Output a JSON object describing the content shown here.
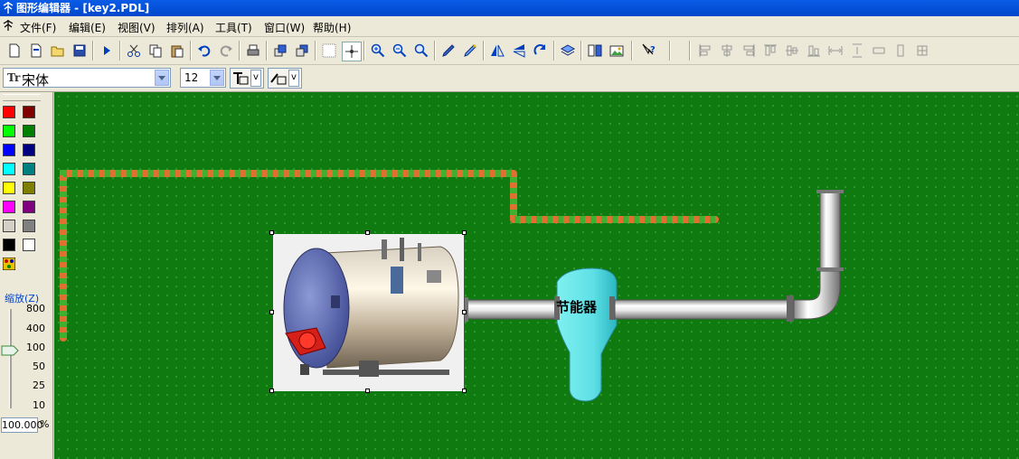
{
  "window": {
    "title": "图形编辑器 - [key2.PDL]"
  },
  "menu": {
    "items": [
      {
        "label": "文件(F)"
      },
      {
        "label": "编辑(E)"
      },
      {
        "label": "视图(V)"
      },
      {
        "label": "排列(A)"
      },
      {
        "label": "工具(T)"
      },
      {
        "label": "窗口(W)"
      },
      {
        "label": "帮助(H)"
      }
    ]
  },
  "toolbar": {
    "buttons": [
      "new-icon",
      "new-template-icon",
      "open-icon",
      "save-icon",
      "run-icon",
      "cut-icon",
      "copy-icon",
      "paste-icon",
      "undo-icon",
      "redo-icon",
      "print-icon",
      "bring-front-icon",
      "send-back-icon",
      "grid-icon",
      "snap-icon",
      "zoom-in-icon",
      "zoom-out-icon",
      "zoom-fit-icon",
      "pen-icon",
      "brush-icon",
      "flip-horizontal-icon",
      "flip-vertical-icon",
      "rotate-icon",
      "layer-icon",
      "group-icon",
      "image-icon",
      "help-icon",
      "align-left-icon",
      "align-center-icon",
      "align-right-icon",
      "align-top-icon",
      "align-middle-icon",
      "align-bottom-icon",
      "distribute-h-icon",
      "distribute-v-icon",
      "same-width-icon",
      "same-height-icon",
      "same-size-icon"
    ]
  },
  "format": {
    "font_name": "宋体",
    "font_size": "12",
    "font_prefix": "Tr",
    "line_style_caret": "v",
    "fill_style_caret": "v"
  },
  "palette": {
    "colors": [
      "#ff0000",
      "#800000",
      "#00ff00",
      "#008000",
      "#0000ff",
      "#000080",
      "#00ffff",
      "#008080",
      "#ffff00",
      "#808000",
      "#ff00ff",
      "#800080",
      "#d4d0c8",
      "#808080",
      "#000000",
      "#ffffff"
    ]
  },
  "zoom": {
    "label": "缩放(Z)",
    "ticks": [
      "800",
      "400",
      "100",
      "50",
      "25",
      "10"
    ],
    "value": "100.000",
    "unit": "%"
  },
  "canvas": {
    "economizer_label": "节能器",
    "background_color": "#0f7a0f"
  }
}
